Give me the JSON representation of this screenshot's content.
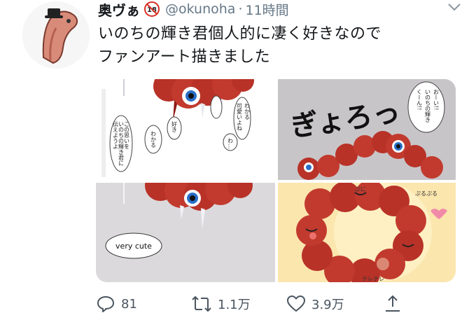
{
  "tweet": {
    "display_name": "奥ヴぁ",
    "handle": "@okunoha",
    "separator": "·",
    "time": "11時間",
    "text_lines": [
      "いのちの輝き君個人的に凄く好きなので",
      "ファンアート描きました"
    ]
  },
  "panels": {
    "p1_bubbles": [
      "この思いを",
      "いのちの輝き君に",
      "伝えようよ",
      "わかる",
      "好き",
      "わかる",
      "可愛いよね",
      "わ…"
    ],
    "p2_shout": "ぎょろっ",
    "p2_bubble": [
      "おーい!!",
      "いのちの輝き",
      "くーん!!"
    ],
    "p3_bubble": "very cute",
    "p4_sfx": [
      "ぷに",
      "ぷるぷる",
      "テレテレ"
    ]
  },
  "actions": {
    "reply_count": "81",
    "retweet_count": "1.1万",
    "like_count": "3.9万"
  },
  "colors": {
    "text": "#14171a",
    "secondary": "#657786",
    "flesh": "#c0392b",
    "eye_blue": "#2a6fc9"
  }
}
